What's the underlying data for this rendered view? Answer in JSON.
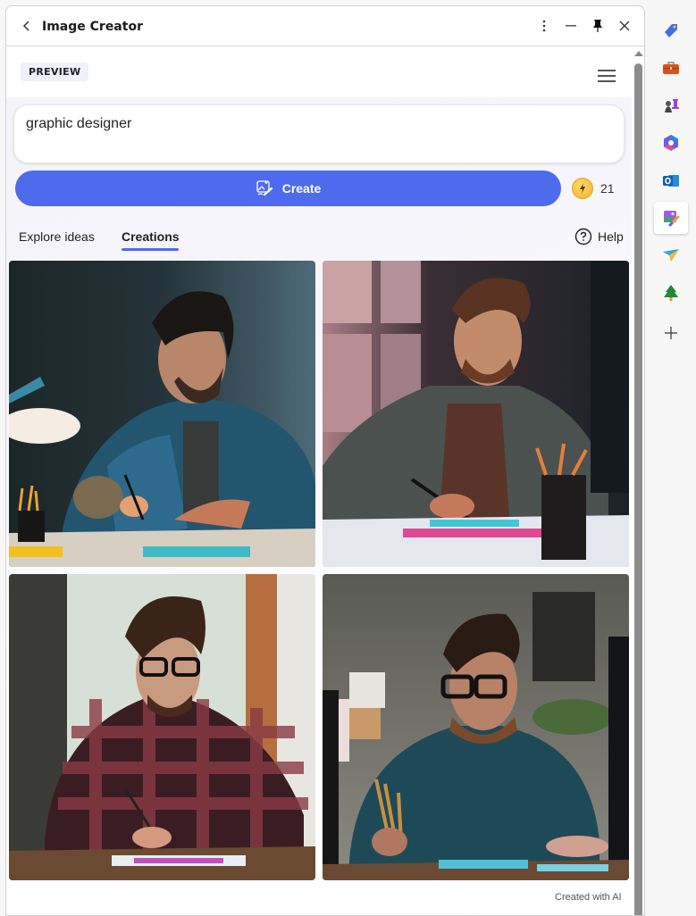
{
  "window": {
    "title": "Image Creator",
    "controls": [
      "more-options",
      "minimize",
      "pin",
      "close"
    ]
  },
  "header": {
    "badge": "PREVIEW"
  },
  "prompt": {
    "value": "graphic designer"
  },
  "create_button": {
    "label": "Create"
  },
  "boosts": {
    "count": "21"
  },
  "tabs": [
    {
      "label": "Explore ideas",
      "active": false
    },
    {
      "label": "Creations",
      "active": true
    }
  ],
  "help": {
    "label": "Help"
  },
  "images": [
    {
      "description": "Man with beard in denim shirt drawing at desk under lamp"
    },
    {
      "description": "Man in grey jacket drawing at desk with colored markers"
    },
    {
      "description": "Man with glasses in plaid shirt drawing on tablet"
    },
    {
      "description": "Man with glasses in teal shirt holding pencils at desk"
    }
  ],
  "footer": {
    "note": "Created with AI"
  },
  "colors": {
    "accent": "#4f6bed",
    "boost_coin": "#f2b530"
  },
  "sidebar": {
    "items": [
      {
        "name": "shopping-tag",
        "active": false
      },
      {
        "name": "tools-toolbox",
        "active": false
      },
      {
        "name": "games-chess",
        "active": false
      },
      {
        "name": "microsoft-365",
        "active": false
      },
      {
        "name": "outlook",
        "active": false
      },
      {
        "name": "image-creator",
        "active": true
      },
      {
        "name": "drop-send",
        "active": false
      },
      {
        "name": "tree-app",
        "active": false
      },
      {
        "name": "add",
        "active": false
      }
    ]
  }
}
